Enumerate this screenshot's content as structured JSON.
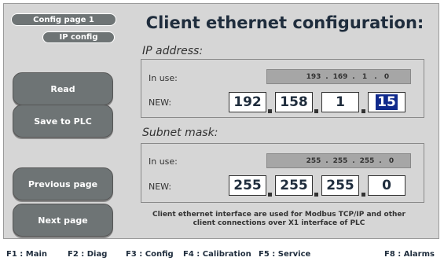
{
  "sidebar": {
    "config_page": "Config page 1",
    "ip_config": "IP config",
    "read": "Read",
    "save": "Save to PLC",
    "previous": "Previous page",
    "next": "Next page"
  },
  "main": {
    "title": "Client ethernet configuration:",
    "ip_section": "IP address:",
    "subnet_section": "Subnet mask:",
    "in_use_label": "In use:",
    "new_label": "NEW:",
    "ip_in_use": [
      "193",
      "169",
      "1",
      "0"
    ],
    "ip_new": [
      "192",
      "158",
      "1",
      "15"
    ],
    "subnet_in_use": [
      "255",
      "255",
      "255",
      "0"
    ],
    "subnet_new": [
      "255",
      "255",
      "255",
      "0"
    ],
    "info_line1": "Client ethernet interface are used for Modbus TCP/IP and other",
    "info_line2": "client connections over X1 interface of PLC"
  },
  "fkeys": {
    "f1": "F1 : Main",
    "f2": "F2 : Diag",
    "f3": "F3 : Config",
    "f4": "F4 : Calibration",
    "f5": "F5 : Service",
    "f8": "F8 : Alarms"
  }
}
